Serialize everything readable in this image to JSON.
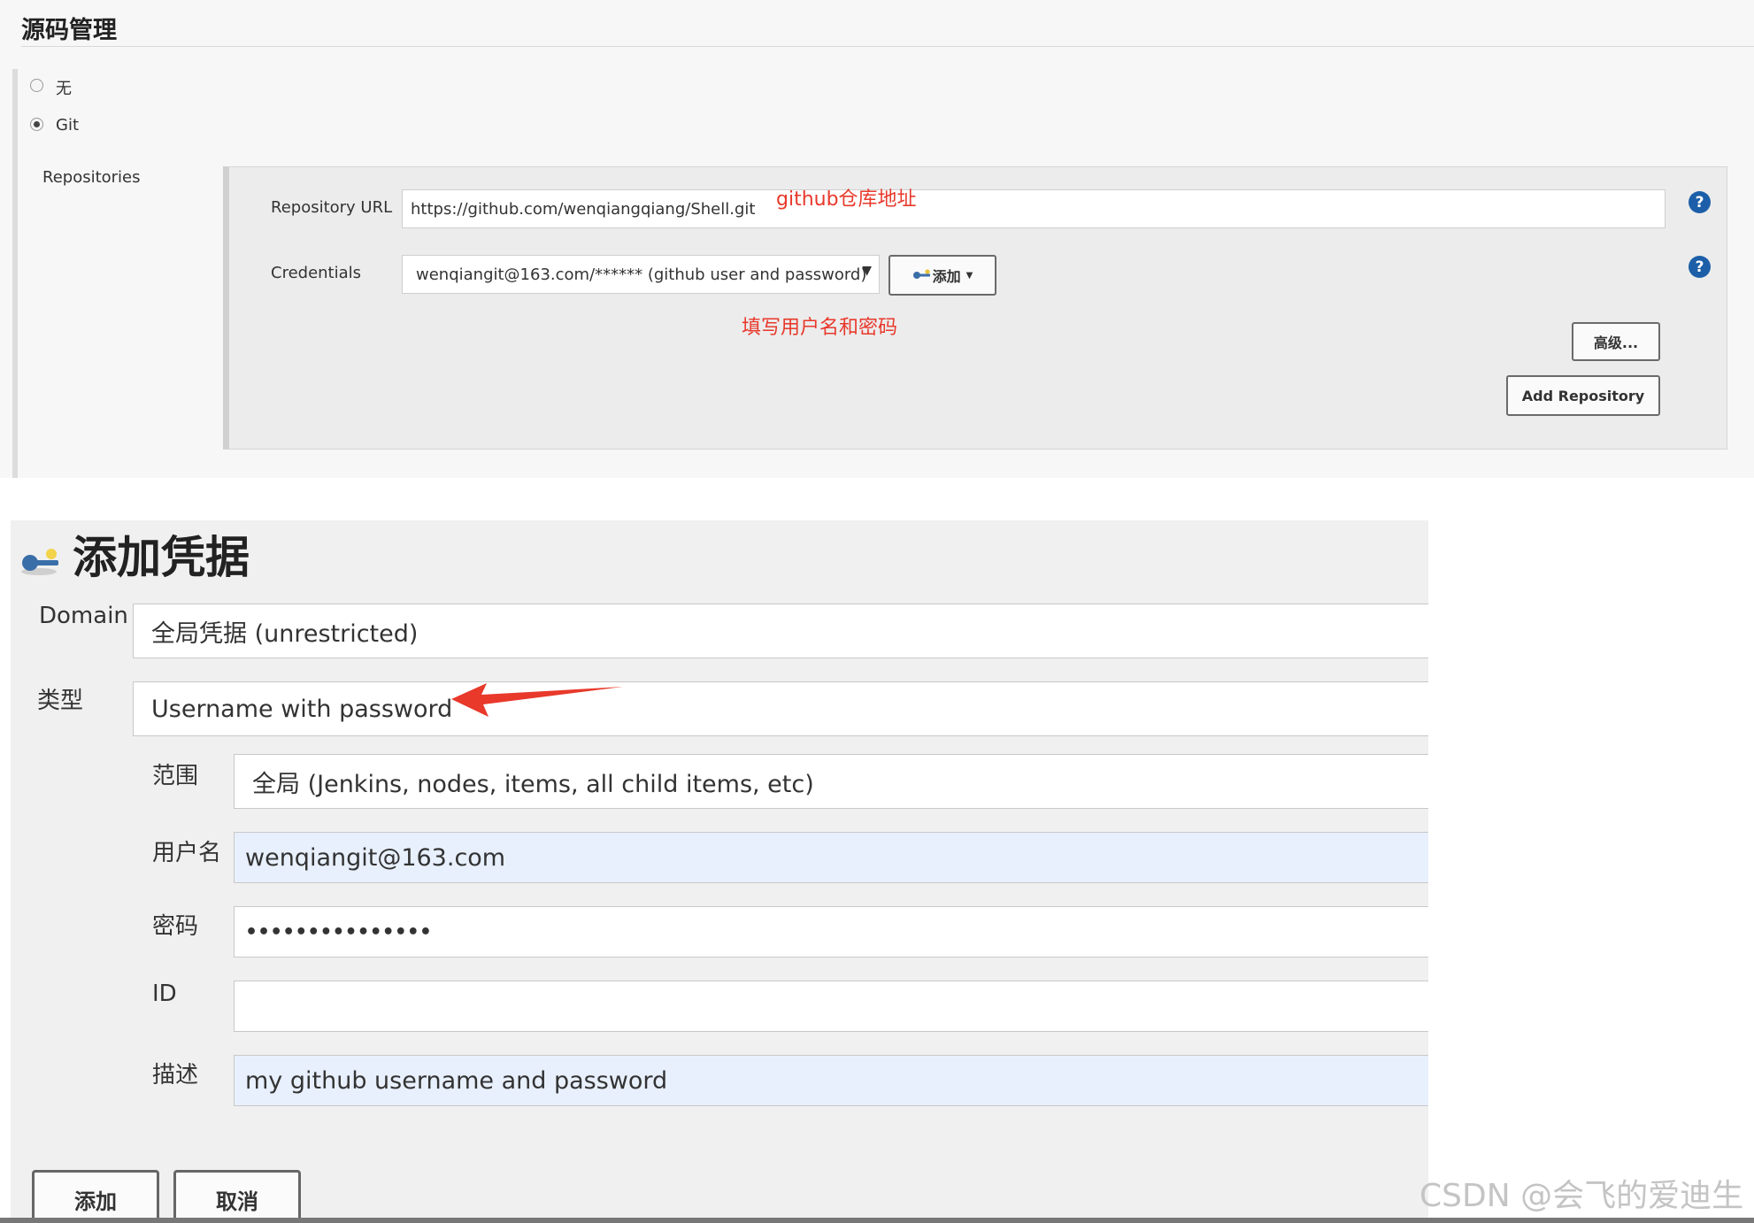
{
  "scm": {
    "title": "源码管理",
    "options": [
      {
        "label": "无",
        "selected": false
      },
      {
        "label": "Git",
        "selected": true
      }
    ],
    "repositories_label": "Repositories",
    "repository_url": {
      "label": "Repository URL",
      "value": "https://github.com/wenqiangqiang/Shell.git",
      "annotation": "github仓库地址"
    },
    "credentials": {
      "label": "Credentials",
      "value": "wenqiangit@163.com/****** (github user and password)",
      "add_button": "添加",
      "annotation": "填写用户名和密码"
    },
    "advanced_button": "高级...",
    "add_repository_button": "Add Repository",
    "help_glyph": "?"
  },
  "credential_dialog": {
    "title": "添加凭据",
    "domain": {
      "label": "Domain",
      "value": "全局凭据 (unrestricted)"
    },
    "kind": {
      "label": "类型",
      "value": "Username with password"
    },
    "scope": {
      "label": "范围",
      "value": "全局 (Jenkins, nodes, items, all child items, etc)"
    },
    "username": {
      "label": "用户名",
      "value": "wenqiangit@163.com"
    },
    "password": {
      "label": "密码",
      "value": "•••••••••••••••"
    },
    "id": {
      "label": "ID",
      "value": ""
    },
    "description": {
      "label": "描述",
      "value": "my github username and password"
    },
    "add_button": "添加",
    "cancel_button": "取消"
  },
  "watermark": "CSDN @会飞的爱迪生",
  "colors": {
    "annotation": "#e8392b",
    "help": "#1c5fa8",
    "filled_input": "#e8f0fe"
  }
}
